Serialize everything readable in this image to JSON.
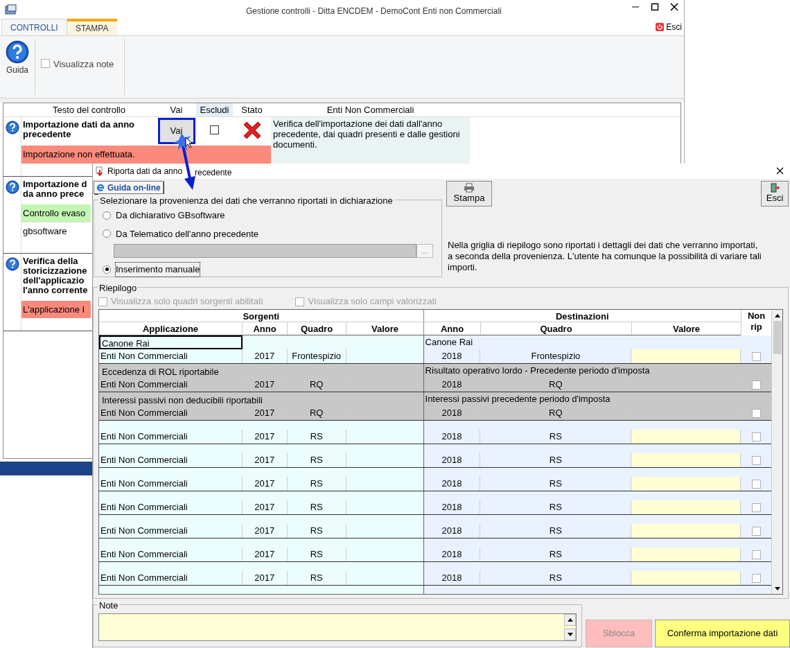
{
  "window": {
    "title": "Gestione controlli - Ditta ENCDEM - DemoCont Enti non Commerciali"
  },
  "tabs": [
    {
      "label": "CONTROLLI",
      "selected": true
    },
    {
      "label": "STAMPA",
      "selected": false
    }
  ],
  "exit_button": "Esci",
  "toolbar": {
    "help_button": "Guida",
    "show_notes": {
      "label": "Visualizza note",
      "checked": false
    }
  },
  "controls_table": {
    "columns": [
      "Testo del controllo",
      "Vai",
      "Escludi",
      "Stato",
      "Enti Non Commerciali"
    ],
    "rows": [
      {
        "title_lines": [
          "Importazione dati da anno",
          "precedente"
        ],
        "go_button": "Vai",
        "excluded": false,
        "passed": false,
        "description": "Verifica dell'importazione dei dati dall'anno precedente, dai quadri presenti e dalle gestioni documenti.",
        "message": {
          "text": "Importazione non effettuata.",
          "color": "#f98a7c"
        }
      },
      {
        "title_lines": [
          "Importazione d",
          "da anno prece"
        ],
        "message": {
          "text": "Controllo evaso",
          "color": "#c4f7b4"
        },
        "note": "gbsoftware"
      },
      {
        "title_lines": [
          "Verifica della",
          "storicizzazione",
          "dell'applicazio",
          "l'anno corrente"
        ],
        "message": {
          "text": "L'applicazione I",
          "color": "#f98a7c"
        }
      }
    ]
  },
  "dialog": {
    "title_parts": [
      "Riporta dati da anno",
      "recedente"
    ],
    "help_button": "Guida on-line",
    "print_button": "Stampa",
    "exit_button": "Esci",
    "source_group": {
      "legend": "Selezionare la provenienza dei dati che verranno riportati in dichiarazione",
      "options": [
        {
          "label": "Da dichiarativo GBsoftware",
          "selected": false
        },
        {
          "label": "Da Telematico dell'anno precedente",
          "selected": false
        },
        {
          "label": "Inserimento manuale",
          "selected": true
        }
      ],
      "browse_button": "..."
    },
    "info": "Nella griglia di riepilogo sono riportati i dettagli dei dati che verranno importati, a seconda della provenienza. L'utente ha comunque la possibilità di variare tali importi.",
    "summary": {
      "legend": "Riepilogo",
      "filters": [
        {
          "label": "Visualizza solo quadri sorgenti abilitati",
          "checked": false,
          "disabled": true
        },
        {
          "label": "Visualizza solo campi valorizzati",
          "checked": false,
          "disabled": true
        }
      ],
      "groups": [
        "Sorgenti",
        "Destinazioni"
      ],
      "columns": [
        "Applicazione",
        "Anno",
        "Quadro",
        "Valore",
        "Anno",
        "Quadro",
        "Valore",
        "Non rip"
      ],
      "rows": [
        {
          "source": "Canone Rai",
          "destination": "Canone Rai",
          "focused": true,
          "disabled": false,
          "application": "Enti Non Commerciali",
          "source_year": "2017",
          "source_section": "Frontespizio",
          "dest_year": "2018",
          "dest_section": "Frontespizio",
          "not_carried": false
        },
        {
          "source": "Eccedenza di ROL riportabile",
          "destination": "Risultato operativo lordo - Precedente periodo d'imposta",
          "focused": false,
          "disabled": true,
          "application": "Enti Non Commerciali",
          "source_year": "2017",
          "source_section": "RQ",
          "dest_year": "2018",
          "dest_section": "RQ",
          "not_carried": false
        },
        {
          "source": "Interessi passivi non deducibili riportabili",
          "destination": "Interessi passivi precedente periodo d'imposta",
          "focused": false,
          "disabled": true,
          "application": "Enti Non Commerciali",
          "source_year": "2017",
          "source_section": "RQ",
          "dest_year": "2018",
          "dest_section": "RQ",
          "not_carried": false
        },
        {
          "disabled": false,
          "application": "Enti Non Commerciali",
          "source_year": "2017",
          "source_section": "RS",
          "dest_year": "2018",
          "dest_section": "RS",
          "not_carried": false
        },
        {
          "disabled": false,
          "application": "Enti Non Commerciali",
          "source_year": "2017",
          "source_section": "RS",
          "dest_year": "2018",
          "dest_section": "RS",
          "not_carried": false
        },
        {
          "disabled": false,
          "application": "Enti Non Commerciali",
          "source_year": "2017",
          "source_section": "RS",
          "dest_year": "2018",
          "dest_section": "RS",
          "not_carried": false
        },
        {
          "disabled": false,
          "application": "Enti Non Commerciali",
          "source_year": "2017",
          "source_section": "RS",
          "dest_year": "2018",
          "dest_section": "RS",
          "not_carried": false
        },
        {
          "disabled": false,
          "application": "Enti Non Commerciali",
          "source_year": "2017",
          "source_section": "RS",
          "dest_year": "2018",
          "dest_section": "RS",
          "not_carried": false
        },
        {
          "disabled": false,
          "application": "Enti Non Commerciali",
          "source_year": "2017",
          "source_section": "RS",
          "dest_year": "2018",
          "dest_section": "RS",
          "not_carried": false
        },
        {
          "disabled": false,
          "application": "Enti Non Commerciali",
          "source_year": "2017",
          "source_section": "RS",
          "dest_year": "2018",
          "dest_section": "RS",
          "not_carried": false
        }
      ]
    },
    "notes": {
      "legend": "Note"
    },
    "unlock_button": {
      "label": "Sblocca",
      "disabled": true
    },
    "confirm_button": "Conferma importazione dati"
  }
}
